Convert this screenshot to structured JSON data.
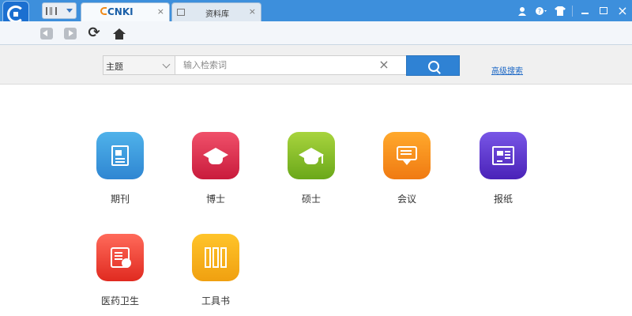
{
  "tabs": [
    {
      "label": "CNKI",
      "close": "×"
    },
    {
      "label": "资料库",
      "close": "×"
    }
  ],
  "window_controls": {
    "close": "×"
  },
  "nav": {
    "refresh": "⟳"
  },
  "search": {
    "field_label": "主题",
    "placeholder": "输入检索词",
    "clear": "×",
    "advanced_link": "高级搜索"
  },
  "categories": [
    {
      "label": "期刊",
      "icon": "journal-icon"
    },
    {
      "label": "博士",
      "icon": "doctor-cap-icon"
    },
    {
      "label": "硕士",
      "icon": "master-cap-icon"
    },
    {
      "label": "会议",
      "icon": "conference-icon"
    },
    {
      "label": "报纸",
      "icon": "newspaper-icon"
    },
    {
      "label": "医药卫生",
      "icon": "medicine-icon"
    },
    {
      "label": "工具书",
      "icon": "reference-book-icon"
    }
  ],
  "colors": {
    "titlebar": "#3d8fdc",
    "search_button": "#2f82d4",
    "link": "#1a66c5"
  }
}
